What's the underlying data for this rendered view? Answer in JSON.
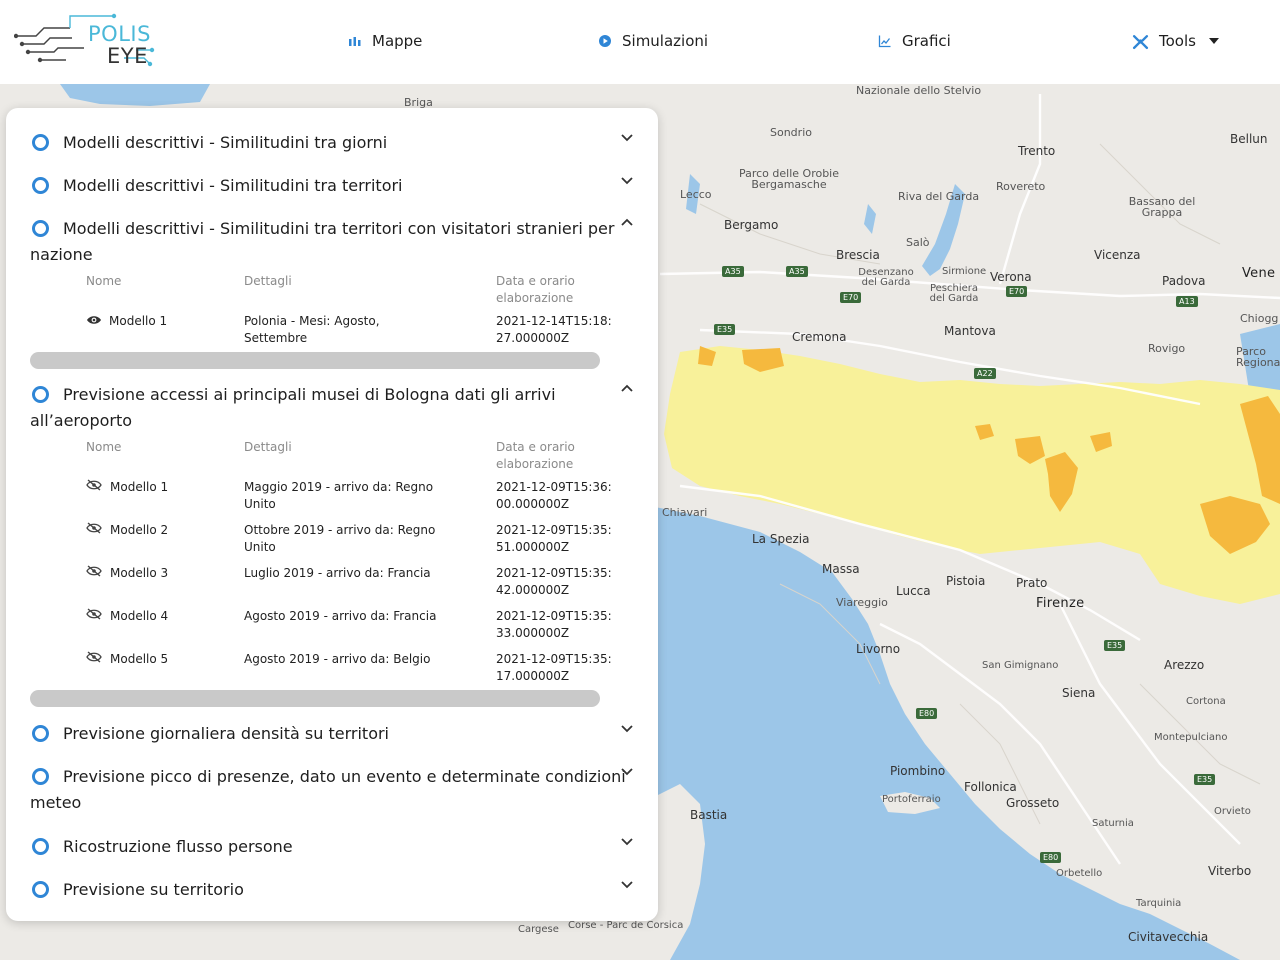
{
  "header": {
    "logo_top": "POLIS",
    "logo_bottom": "EYE",
    "nav": [
      {
        "label": "Mappe",
        "icon": "map-bars-icon"
      },
      {
        "label": "Simulazioni",
        "icon": "play-circle-icon"
      },
      {
        "label": "Grafici",
        "icon": "chart-icon"
      },
      {
        "label": "Tools",
        "icon": "tools-icon"
      }
    ],
    "accent_color": "#2f86d6"
  },
  "panel": {
    "columns": {
      "name": "Nome",
      "details": "Dettagli",
      "date": "Data e orario elaborazione"
    },
    "sections": [
      {
        "title": "Modelli descrittivi - Similitudini tra giorni",
        "expanded": false
      },
      {
        "title": "Modelli descrittivi - Similitudini tra territori",
        "expanded": false
      },
      {
        "title": "Modelli descrittivi - Similitudini tra territori con visitatori stranieri per nazione",
        "expanded": true,
        "rows": [
          {
            "name": "Modello 1",
            "details": "Polonia - Mesi: Agosto, Settembre",
            "date": "2021-12-14T15:18:27.000000Z",
            "visible": true
          }
        ]
      },
      {
        "title": "Previsione accessi ai principali musei di Bologna dati gli arrivi all’aeroporto",
        "expanded": true,
        "rows": [
          {
            "name": "Modello 1",
            "details": "Maggio 2019 - arrivo da: Regno Unito",
            "date": "2021-12-09T15:36:00.000000Z",
            "visible": false
          },
          {
            "name": "Modello 2",
            "details": "Ottobre 2019 - arrivo da: Regno Unito",
            "date": "2021-12-09T15:35:51.000000Z",
            "visible": false
          },
          {
            "name": "Modello 3",
            "details": "Luglio 2019 - arrivo da: Francia",
            "date": "2021-12-09T15:35:42.000000Z",
            "visible": false
          },
          {
            "name": "Modello 4",
            "details": "Agosto 2019 - arrivo da: Francia",
            "date": "2021-12-09T15:35:33.000000Z",
            "visible": false
          },
          {
            "name": "Modello 5",
            "details": "Agosto 2019 - arrivo da: Belgio",
            "date": "2021-12-09T15:35:17.000000Z",
            "visible": false
          }
        ]
      },
      {
        "title": "Previsione giornaliera densità su territori",
        "expanded": false
      },
      {
        "title": "Previsione picco di presenze, dato un evento e determinate condizioni meteo",
        "expanded": false
      },
      {
        "title": "Ricostruzione flusso persone",
        "expanded": false
      },
      {
        "title": "Previsione su territorio",
        "expanded": false
      }
    ]
  },
  "map": {
    "labels": {
      "nazionale_stelvio": "Nazionale dello Stelvio",
      "sondrio": "Sondrio",
      "trento": "Trento",
      "belluno": "Bellun",
      "lecco": "Lecco",
      "orobie": "Parco delle Orobie Bergamasche",
      "riva": "Riva del Garda",
      "rovereto": "Rovereto",
      "bassano": "Bassano del Grappa",
      "bergamo": "Bergamo",
      "brescia": "Brescia",
      "salo": "Salò",
      "vicenza": "Vicenza",
      "desenzano": "Desenzano del Garda",
      "sirmione": "Sirmione",
      "verona": "Verona",
      "peschiera": "Peschiera del Garda",
      "padova": "Padova",
      "mantova": "Mantova",
      "cremona": "Cremona",
      "rovigo": "Rovigo",
      "la_spezia": "La Spezia",
      "chiavari": "Chiavari",
      "massa": "Massa",
      "pistoia": "Pistoia",
      "prato": "Prato",
      "lucca": "Lucca",
      "viareggio": "Viareggio",
      "firenze": "Firenze",
      "livorno": "Livorno",
      "san_gimignano": "San Gimignano",
      "arezzo": "Arezzo",
      "siena": "Siena",
      "cortona": "Cortona",
      "montepulciano": "Montepulciano",
      "piombino": "Piombino",
      "follonica": "Follonica",
      "grosseto": "Grosseto",
      "portoferraio": "Portoferraio",
      "bastia": "Bastia",
      "saturnia": "Saturnia",
      "orbetello": "Orbetello",
      "viterbo": "Viterbo",
      "civitavecchia": "Civitavecchia",
      "briga": "Briga",
      "corse": "Corse - Parc de Corsica",
      "venezia": "Vene",
      "chioggia": "Chiogg",
      "parco_regionale": "Parco Regionale",
      "tarquinia": "Tarquinia",
      "orvieto": "Orvieto",
      "carcassone": "Cargese"
    },
    "colors": {
      "sea": "#9cc6e8",
      "land": "#eceae6",
      "region": "#f8f19a",
      "hotspot": "#f5b93e",
      "road": "#ffffff"
    }
  }
}
